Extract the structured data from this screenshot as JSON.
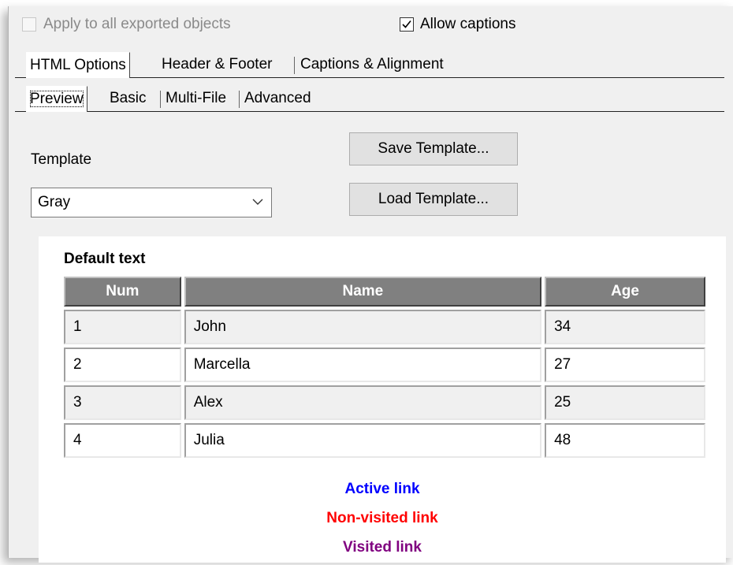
{
  "options": {
    "apply_all_label": "Apply to all exported objects",
    "allow_captions_label": "Allow captions"
  },
  "main_tabs": [
    "HTML Options",
    "Header & Footer",
    "Captions & Alignment"
  ],
  "sub_tabs": [
    "Preview",
    "Basic",
    "Multi-File",
    "Advanced"
  ],
  "template": {
    "label": "Template",
    "selected": "Gray"
  },
  "buttons": {
    "save": "Save Template...",
    "load": "Load Template..."
  },
  "preview": {
    "default_text": "Default text",
    "columns": [
      "Num",
      "Name",
      "Age"
    ],
    "rows": [
      [
        "1",
        "John",
        "34"
      ],
      [
        "2",
        "Marcella",
        "27"
      ],
      [
        "3",
        "Alex",
        "25"
      ],
      [
        "4",
        "Julia",
        "48"
      ]
    ],
    "links": {
      "active": "Active link",
      "non_visited": "Non-visited link",
      "visited": "Visited link"
    }
  },
  "colors": {
    "header_bg": "#808080",
    "active_link": "#0000ff",
    "non_visited_link": "#ff0000",
    "visited_link": "#800080"
  },
  "icons": {
    "checkbox_checked": "checkmark-icon",
    "dropdown": "chevron-down-icon"
  }
}
